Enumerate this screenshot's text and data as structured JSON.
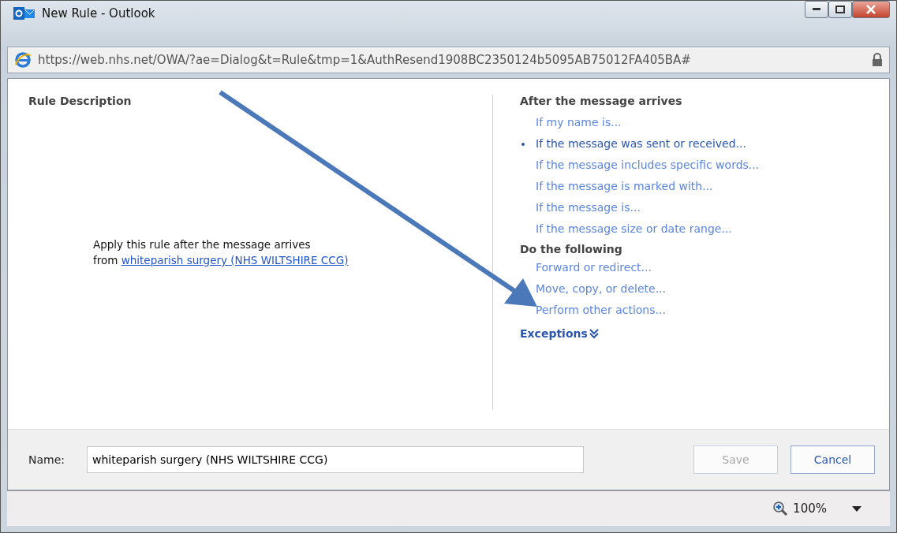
{
  "window": {
    "title": "New Rule - Outlook"
  },
  "address": {
    "url": "https://web.nhs.net/OWA/?ae=Dialog&t=Rule&tmp=1&AuthResend1908BC2350124b5095AB75012FA405BA#"
  },
  "description": {
    "heading": "Rule Description",
    "line_1": "Apply this rule after the message arrives",
    "line_2_prefix": "from",
    "link": "whiteparish surgery (NHS WILTSHIRE CCG)"
  },
  "conditions": {
    "heading": "After the message arrives",
    "items": [
      {
        "label": "If my name is...",
        "selected": false
      },
      {
        "label": "If the message was sent or received...",
        "selected": true
      },
      {
        "label": "If the message includes specific words...",
        "selected": false
      },
      {
        "label": "If the message is marked with...",
        "selected": false
      },
      {
        "label": "If the message is...",
        "selected": false
      },
      {
        "label": "If the message size or date range...",
        "selected": false
      }
    ]
  },
  "actions": {
    "heading": "Do the following",
    "items": [
      {
        "label": "Forward or redirect...",
        "selected": false
      },
      {
        "label": "Move, copy, or delete...",
        "selected": false
      },
      {
        "label": "Perform other actions...",
        "selected": false
      }
    ]
  },
  "exceptions": {
    "label": "Exceptions"
  },
  "footer": {
    "name_label": "Name:",
    "name_value": "whiteparish surgery (NHS WILTSHIRE CCG)",
    "buttons": [
      {
        "label": "Save",
        "disabled": true
      },
      {
        "label": "Cancel",
        "disabled": false
      }
    ]
  },
  "status_bar": {
    "zoom": "100%"
  }
}
